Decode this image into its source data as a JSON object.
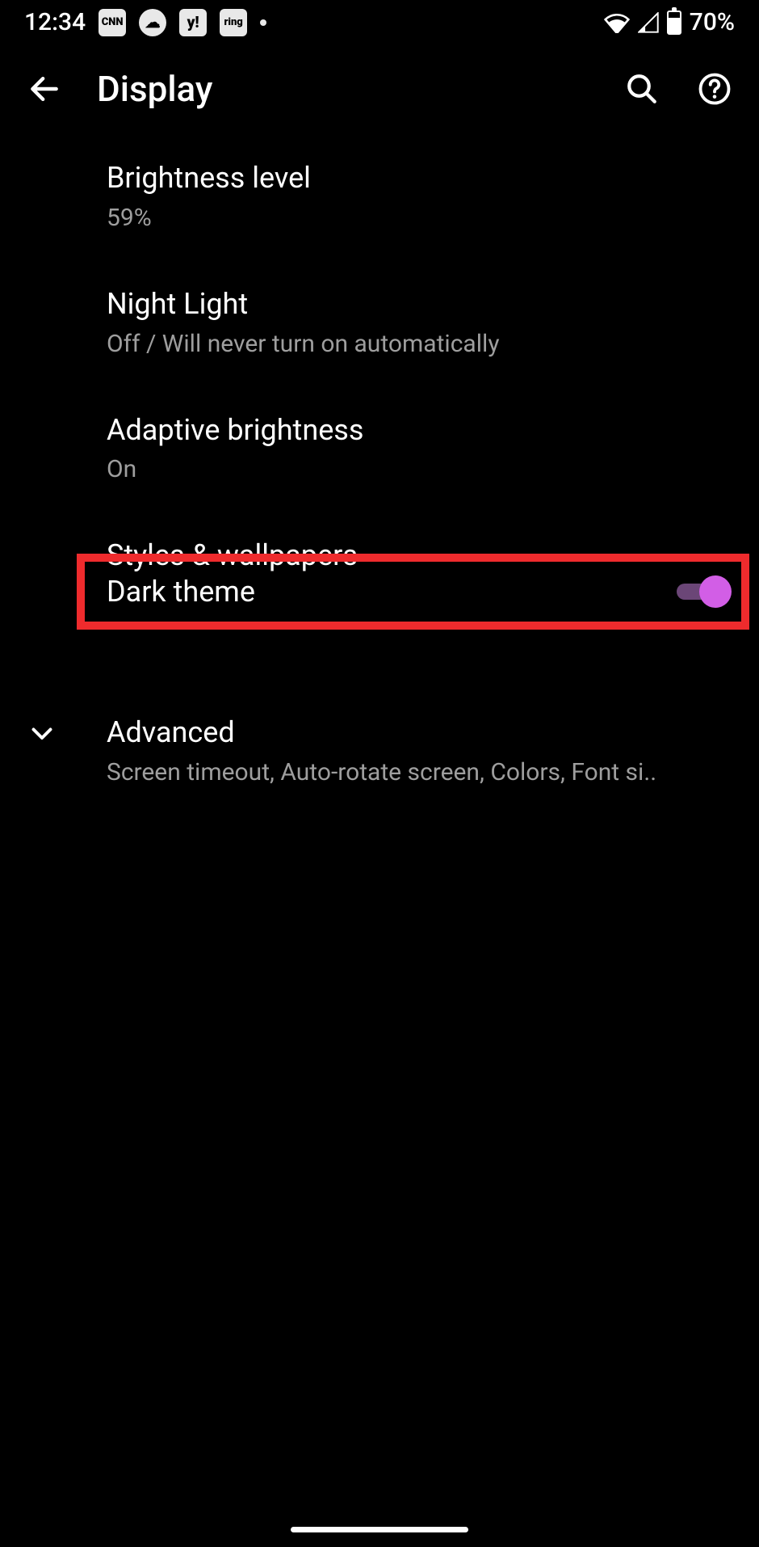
{
  "status_bar": {
    "time": "12:34",
    "notif_icons": [
      "cnn-icon",
      "weather-icon",
      "yahoo-icon",
      "ring-icon"
    ],
    "notif_labels": [
      "CNN",
      "☁",
      "y!",
      "ring"
    ],
    "battery_text": "70%",
    "battery_level_pct": 70
  },
  "header": {
    "title": "Display"
  },
  "items": {
    "brightness": {
      "title": "Brightness level",
      "sub": "59%"
    },
    "night_light": {
      "title": "Night Light",
      "sub": "Off / Will never turn on automatically"
    },
    "adaptive": {
      "title": "Adaptive brightness",
      "sub": "On"
    },
    "styles": {
      "title": "Styles & wallpapers"
    },
    "dark_theme": {
      "title": "Dark theme",
      "toggle_on": true
    },
    "advanced": {
      "title": "Advanced",
      "sub": "Screen timeout, Auto-rotate screen, Colors, Font si.."
    }
  },
  "colors": {
    "accent": "#d25ee6",
    "highlight_box": "#ef2b2d"
  }
}
